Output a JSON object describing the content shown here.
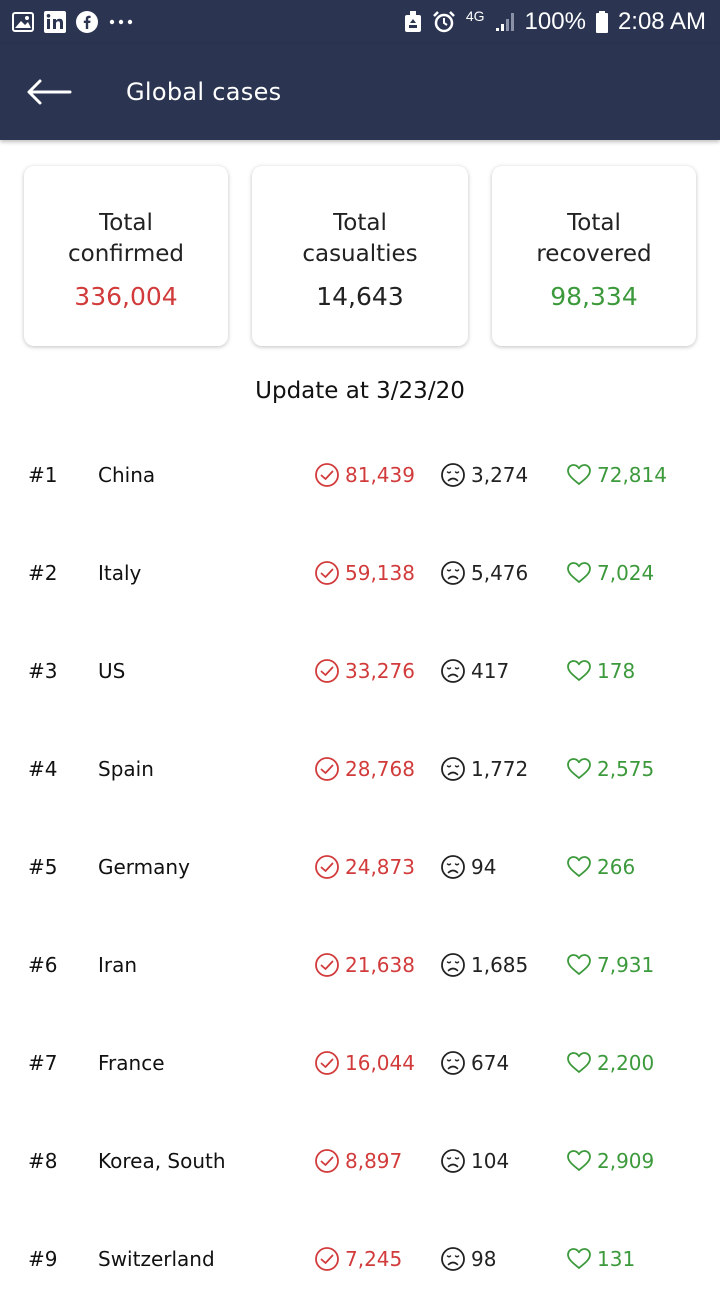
{
  "status_bar": {
    "network": "4G",
    "battery": "100%",
    "time": "2:08 AM",
    "left_icons": [
      "image-icon",
      "linkedin-icon",
      "facebook-icon",
      "more-dots-icon"
    ],
    "right_icons": [
      "recycle-icon",
      "alarm-icon",
      "signal-icon",
      "battery-icon"
    ]
  },
  "header": {
    "title": "Global cases"
  },
  "summary": {
    "confirmed": {
      "label_line1": "Total",
      "label_line2": "confirmed",
      "value": "336,004"
    },
    "casualties": {
      "label_line1": "Total",
      "label_line2": "casualties",
      "value": "14,643"
    },
    "recovered": {
      "label_line1": "Total",
      "label_line2": "recovered",
      "value": "98,334"
    }
  },
  "update_text": "Update at 3/23/20",
  "countries": [
    {
      "rank": "#1",
      "name": "China",
      "confirmed": "81,439",
      "deaths": "3,274",
      "recovered": "72,814"
    },
    {
      "rank": "#2",
      "name": "Italy",
      "confirmed": "59,138",
      "deaths": "5,476",
      "recovered": "7,024"
    },
    {
      "rank": "#3",
      "name": "US",
      "confirmed": "33,276",
      "deaths": "417",
      "recovered": "178"
    },
    {
      "rank": "#4",
      "name": "Spain",
      "confirmed": "28,768",
      "deaths": "1,772",
      "recovered": "2,575"
    },
    {
      "rank": "#5",
      "name": "Germany",
      "confirmed": "24,873",
      "deaths": "94",
      "recovered": "266"
    },
    {
      "rank": "#6",
      "name": "Iran",
      "confirmed": "21,638",
      "deaths": "1,685",
      "recovered": "7,931"
    },
    {
      "rank": "#7",
      "name": "France",
      "confirmed": "16,044",
      "deaths": "674",
      "recovered": "2,200"
    },
    {
      "rank": "#8",
      "name": "Korea, South",
      "confirmed": "8,897",
      "deaths": "104",
      "recovered": "2,909"
    },
    {
      "rank": "#9",
      "name": "Switzerland",
      "confirmed": "7,245",
      "deaths": "98",
      "recovered": "131"
    }
  ],
  "colors": {
    "header_bg": "#2b3552",
    "confirmed": "#d23b3b",
    "recovered": "#3c9a3c",
    "deaths": "#222222"
  }
}
